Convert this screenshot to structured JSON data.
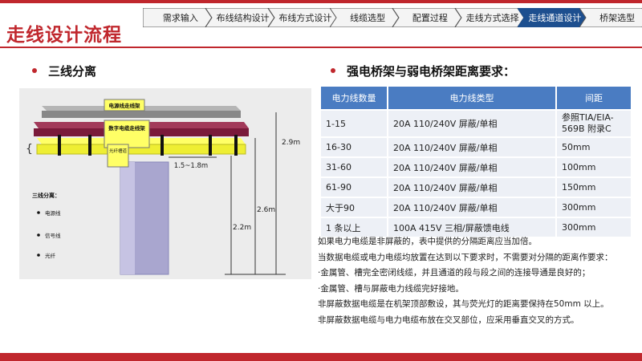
{
  "page": {
    "title": "走线设计流程"
  },
  "process": {
    "steps": [
      "需求输入",
      "布线结构设计",
      "布线方式设计",
      "线缆选型",
      "配置过程",
      "走线方式选择",
      "走线通道设计",
      "桥架选型"
    ],
    "active_index": 6
  },
  "colors": {
    "accent": "#c0272d",
    "table_header": "#4a7cc2",
    "active_step": "#1d4f8f"
  },
  "left": {
    "heading": "三线分离",
    "diagram": {
      "tray_power": "电源线走线架",
      "tray_data": "数字电缆走线架",
      "tray_fiber": "光纤槽道",
      "dim_offset": "1.5~1.8m",
      "dim_29": "2.9m",
      "dim_26": "2.6m",
      "dim_22": "2.2m",
      "brace": "{",
      "legend_title": "三线分离：",
      "legend_items": [
        "电源线",
        "信号线",
        "光纤"
      ]
    }
  },
  "right": {
    "heading": "强电桥架与弱电桥架距离要求：",
    "table": {
      "headers": [
        "电力线数量",
        "电力线类型",
        "间距"
      ],
      "rows": [
        [
          "1-15",
          "20A 110/240V 屏蔽/单相",
          "参照TIA/EIA-569B 附录C"
        ],
        [
          "16-30",
          "20A 110/240V 屏蔽/单相",
          "50mm"
        ],
        [
          "31-60",
          "20A 110/240V 屏蔽/单相",
          "100mm"
        ],
        [
          "61-90",
          "20A 110/240V 屏蔽/单相",
          "150mm"
        ],
        [
          "大于90",
          "20A 110/240V 屏蔽/单相",
          "300mm"
        ],
        [
          "1 条以上",
          "100A 415V 三相/屏蔽馈电线",
          "300mm"
        ]
      ]
    },
    "notes": [
      "如果电力电缆是非屏蔽的，表中提供的分隔距离应当加倍。",
      "当数据电缆或电力电缆均放置在达到以下要求时，不需要对分隔的距离作要求：",
      "·金属管、槽完全密闭线缆，并且通道的段与段之间的连接导通是良好的；",
      "·金属管、槽与屏蔽电力线缆完好接地。",
      "非屏蔽数据电缆是在机架顶部敷设，其与荧光灯的距离要保持在50mm 以上。",
      "非屏蔽数据电缆与电力电缆布放在交叉部位，应采用垂直交叉的方式。"
    ]
  }
}
